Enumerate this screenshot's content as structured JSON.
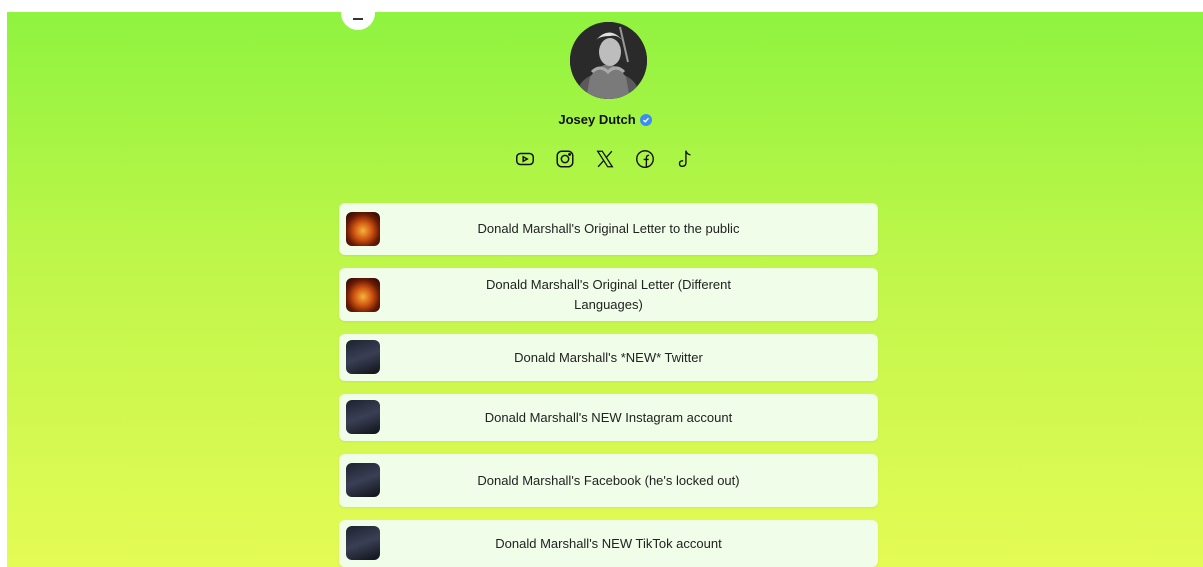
{
  "profile": {
    "name": "Josey Dutch"
  },
  "socials": [
    {
      "icon": "youtube-icon"
    },
    {
      "icon": "instagram-icon"
    },
    {
      "icon": "x-icon"
    },
    {
      "icon": "facebook-icon"
    },
    {
      "icon": "tiktok-icon"
    }
  ],
  "links": [
    {
      "label": "Donald Marshall's Original Letter to the public",
      "thumb": "fire"
    },
    {
      "label": "Donald Marshall's Original Letter (Different Languages)",
      "thumb": "fire"
    },
    {
      "label": "Donald Marshall's *NEW* Twitter",
      "thumb": "poster"
    },
    {
      "label": "Donald Marshall's NEW Instagram account",
      "thumb": "poster"
    },
    {
      "label": "Donald Marshall's Facebook (he's locked out)",
      "thumb": "poster"
    },
    {
      "label": "Donald Marshall's NEW TikTok account",
      "thumb": "poster"
    }
  ],
  "colors": {
    "gradient_top": "#8ff33f",
    "gradient_bottom": "#e4fb55",
    "card_bg": "#effde9",
    "verified": "#3b8df0"
  }
}
